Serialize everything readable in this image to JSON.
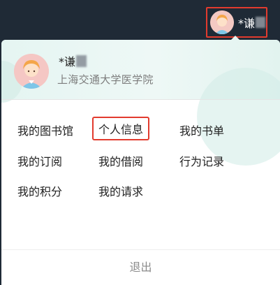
{
  "topbar": {
    "user_name": "*谦"
  },
  "profile": {
    "name": "*谦",
    "organization": "上海交通大学医学院"
  },
  "menu": {
    "items": [
      {
        "label": "我的图书馆"
      },
      {
        "label": "个人信息"
      },
      {
        "label": "我的书单"
      },
      {
        "label": "我的订阅"
      },
      {
        "label": "我的借阅"
      },
      {
        "label": "行为记录"
      },
      {
        "label": "我的积分"
      },
      {
        "label": "我的请求"
      }
    ]
  },
  "footer": {
    "logout_label": "退出"
  },
  "colors": {
    "highlight": "#e23b2e",
    "header_bg": "#1f2a36",
    "panel_head": "#e5f5f2"
  }
}
